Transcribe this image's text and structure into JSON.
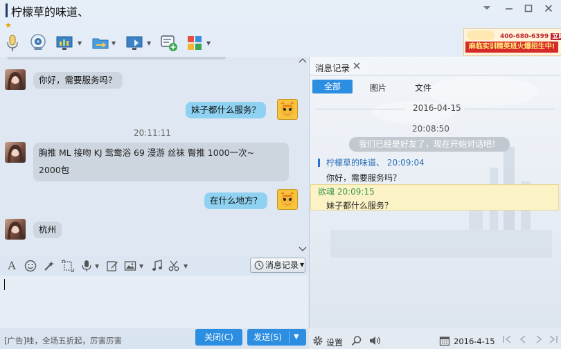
{
  "window": {
    "title": "柠檬草的味道、",
    "controls": [
      "chevron-down-icon",
      "minimize-icon",
      "maximize-icon",
      "close-icon"
    ]
  },
  "toolbar": {
    "icons": [
      "microphone-icon",
      "webcam-icon",
      "screen-share-icon",
      "file-transfer-icon",
      "remote-desktop-icon",
      "message-plus-icon",
      "apps-icon"
    ]
  },
  "ad": {
    "phone": "400-680-6399",
    "badge": "立即咨询",
    "slogan": "麻临实训精英班火爆招生中!"
  },
  "chat": {
    "messages": [
      {
        "side": "left",
        "text": "你好，需要服务吗？"
      },
      {
        "side": "right",
        "text": "妹子都什么服务？"
      },
      {
        "side": "time",
        "text": "20:11:11"
      },
      {
        "side": "left",
        "text": "胸推 ML  接吻 KJ 鸳鸯浴 69 漫游   丝袜  臀推   1000一次~",
        "text2": "2000包"
      },
      {
        "side": "right",
        "text": "在什么地方？"
      },
      {
        "side": "left",
        "text": "杭州"
      }
    ]
  },
  "format_toolbar": {
    "icons": [
      "font-icon",
      "emoji-icon",
      "magic-wand-icon",
      "screenshot-icon",
      "voice-icon",
      "edit-icon",
      "image-icon",
      "music-icon",
      "scissors-icon"
    ],
    "history_button": "消息记录"
  },
  "bottom": {
    "ad_text": "[广告]哇，全场五折起，厉害厉害",
    "close_label": "关闭(C)",
    "send_label": "发送(S)"
  },
  "history": {
    "tab_label": "消息记录",
    "filters": [
      "全部",
      "图片",
      "文件"
    ],
    "date": "2016-04-15",
    "time": "20:08:50",
    "system_msg": "我们已经是好友了，现在开始对话吧！",
    "entry1_name": "柠檬草的味道、 20:09:04",
    "entry1_text": "你好，需要服务吗？",
    "entry2_name": "欲魂  20:09:15",
    "entry2_text": "妹子都什么服务？",
    "footer_settings": "设置",
    "footer_date": "2016-4-15"
  },
  "colors": {
    "accent": "#2c8ee0",
    "bubble_self": "#8fd1f1",
    "bubble_other": "#cdd5de",
    "highlight": "#fbf3c6"
  }
}
